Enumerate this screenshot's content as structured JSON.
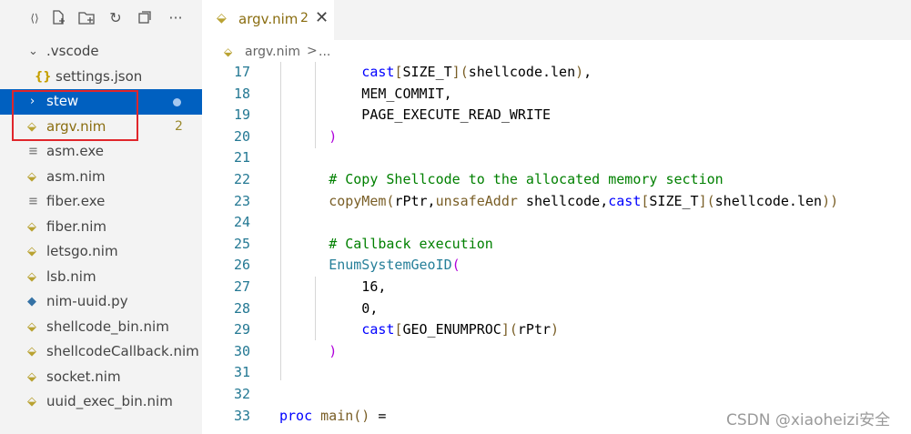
{
  "sidebar": {
    "toolbar_icons": [
      "collapse-icon",
      "new-file-icon",
      "new-folder-icon",
      "refresh-icon",
      "collapse-all-icon",
      "more-icon"
    ],
    "folder_vscode": ".vscode",
    "settings_json": "settings.json",
    "stew": "stew",
    "argv": "argv.nim",
    "argv_count": "2",
    "files": [
      "asm.exe",
      "asm.nim",
      "fiber.exe",
      "fiber.nim",
      "letsgo.nim",
      "lsb.nim",
      "nim-uuid.py",
      "shellcode_bin.nim",
      "shellcodeCallback.nim",
      "socket.nim",
      "uuid_exec_bin.nim"
    ]
  },
  "editor": {
    "tab_label": "argv.nim",
    "tab_problems": "2",
    "breadcrumb_file": "argv.nim",
    "breadcrumb_sep": ">",
    "breadcrumb_more": "...",
    "line_numbers": [
      "17",
      "18",
      "19",
      "20",
      "21",
      "22",
      "23",
      "24",
      "25",
      "26",
      "27",
      "28",
      "29",
      "30",
      "31",
      "32",
      "33"
    ]
  },
  "watermark": "CSDN @xiaoheizi安全",
  "colors": {
    "selection": "#0060c0",
    "highlight_box": "#e0262b"
  }
}
